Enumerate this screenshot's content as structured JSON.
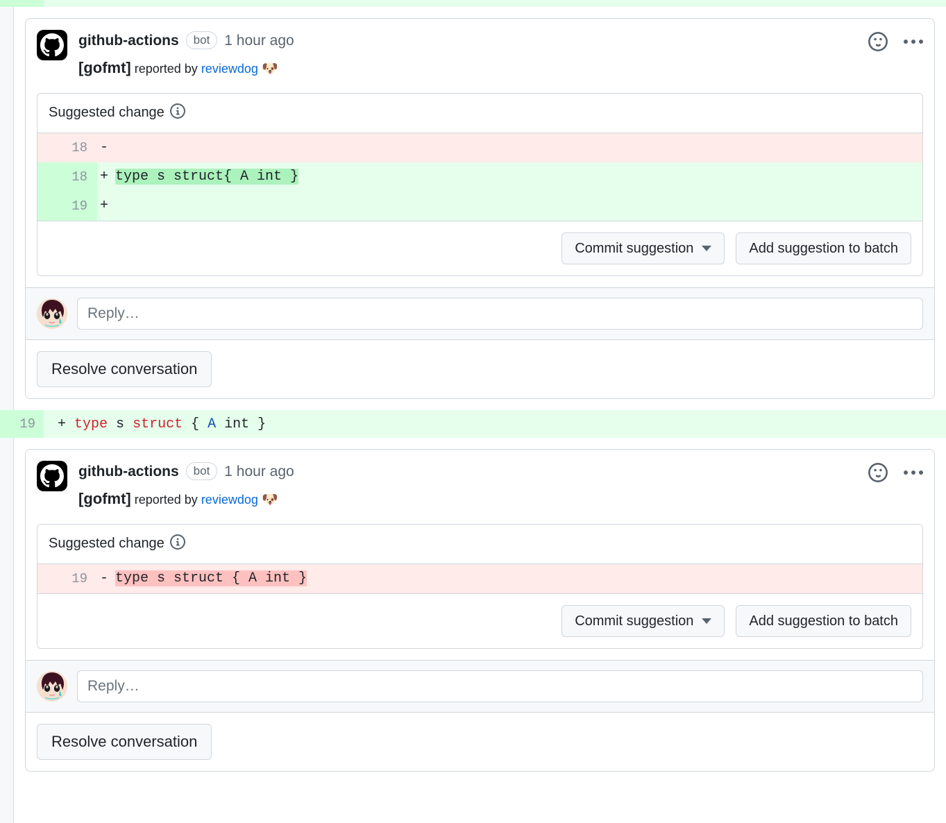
{
  "top_partial_diff": {
    "line_number": "",
    "code": "",
    "type": "addition"
  },
  "threads": [
    {
      "comment": {
        "avatar_icon": "github-logo-icon",
        "author": "github-actions",
        "bot_badge": "bot",
        "timestamp": "1 hour ago",
        "report_prefix": "[gofmt]",
        "report_middle": " reported by ",
        "report_link": "reviewdog",
        "report_emoji": "🐶",
        "reaction_icon": "smiley-icon",
        "menu_icon": "kebab-menu-icon"
      },
      "suggestion": {
        "title": "Suggested change",
        "info_icon": "info-icon",
        "rows": [
          {
            "type": "deletion",
            "line_number": "18",
            "sign": "-",
            "code": ""
          },
          {
            "type": "addition",
            "line_number": "18",
            "sign": "+",
            "code": "type s struct{ A int }"
          },
          {
            "type": "addition",
            "line_number": "19",
            "sign": "+",
            "code": ""
          }
        ],
        "commit_button": "Commit suggestion",
        "commit_caret_icon": "chevron-down-icon",
        "batch_button": "Add suggestion to batch"
      },
      "reply": {
        "avatar_icon": "user-avatar",
        "placeholder": "Reply…",
        "value": ""
      },
      "resolve_button": "Resolve conversation"
    },
    {
      "comment": {
        "avatar_icon": "github-logo-icon",
        "author": "github-actions",
        "bot_badge": "bot",
        "timestamp": "1 hour ago",
        "report_prefix": "[gofmt]",
        "report_middle": " reported by ",
        "report_link": "reviewdog",
        "report_emoji": "🐶",
        "reaction_icon": "smiley-icon",
        "menu_icon": "kebab-menu-icon"
      },
      "suggestion": {
        "title": "Suggested change",
        "info_icon": "info-icon",
        "rows": [
          {
            "type": "deletion",
            "line_number": "19",
            "sign": "-",
            "code": "type s struct { A int }"
          }
        ],
        "commit_button": "Commit suggestion",
        "commit_caret_icon": "chevron-down-icon",
        "batch_button": "Add suggestion to batch"
      },
      "reply": {
        "avatar_icon": "user-avatar",
        "placeholder": "Reply…",
        "value": ""
      },
      "resolve_button": "Resolve conversation"
    }
  ],
  "middle_diff": {
    "line_number": "19",
    "sign": "+",
    "tokens": [
      {
        "text": "type",
        "kind": "keyword"
      },
      {
        "text": " s ",
        "kind": "plain"
      },
      {
        "text": "struct",
        "kind": "keyword"
      },
      {
        "text": " { ",
        "kind": "plain"
      },
      {
        "text": "A",
        "kind": "type"
      },
      {
        "text": " int }",
        "kind": "plain"
      }
    ]
  },
  "colors": {
    "addition_bg": "#e6ffec",
    "addition_gutter": "#ccffd8",
    "addition_highlight": "#abf2bc",
    "deletion_bg": "#ffebe9",
    "deletion_highlight": "#ffc1c0",
    "link": "#0969da",
    "keyword": "#cf222e",
    "type": "#0550ae",
    "border": "#d0d7de",
    "muted_text": "#59636e"
  }
}
